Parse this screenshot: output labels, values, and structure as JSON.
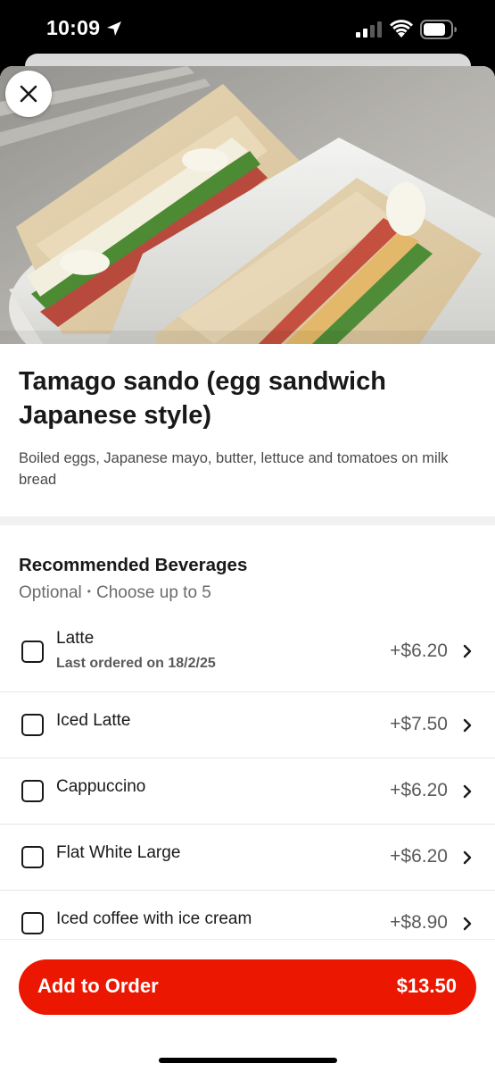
{
  "status_bar": {
    "time": "10:09"
  },
  "item": {
    "title": "Tamago sando (egg sandwich Japanese style)",
    "description": "Boiled eggs, Japanese mayo, butter, lettuce and tomatoes on milk bread"
  },
  "section": {
    "title": "Recommended Beverages",
    "optional": "Optional",
    "separator": "•",
    "choose": "Choose up to 5"
  },
  "options": [
    {
      "name": "Latte",
      "meta": "Last ordered on 18/2/25",
      "price": "+$6.20",
      "checked": false
    },
    {
      "name": "Iced Latte",
      "price": "+$7.50",
      "checked": false
    },
    {
      "name": "Cappuccino",
      "price": "+$6.20",
      "checked": false
    },
    {
      "name": "Flat White Large",
      "price": "+$6.20",
      "checked": false
    },
    {
      "name": "Iced coffee with ice cream",
      "price": "+$8.90",
      "checked": false
    }
  ],
  "cta": {
    "label": "Add to Order",
    "price": "$13.50"
  },
  "colors": {
    "accent": "#eb1700",
    "text": "#191919",
    "muted": "#6b6b6b"
  },
  "icons": {
    "close": "close-icon",
    "chevron": "chevron-right-icon",
    "location": "location-arrow-icon",
    "signal": "cellular-signal-icon",
    "wifi": "wifi-icon",
    "battery": "battery-icon"
  }
}
